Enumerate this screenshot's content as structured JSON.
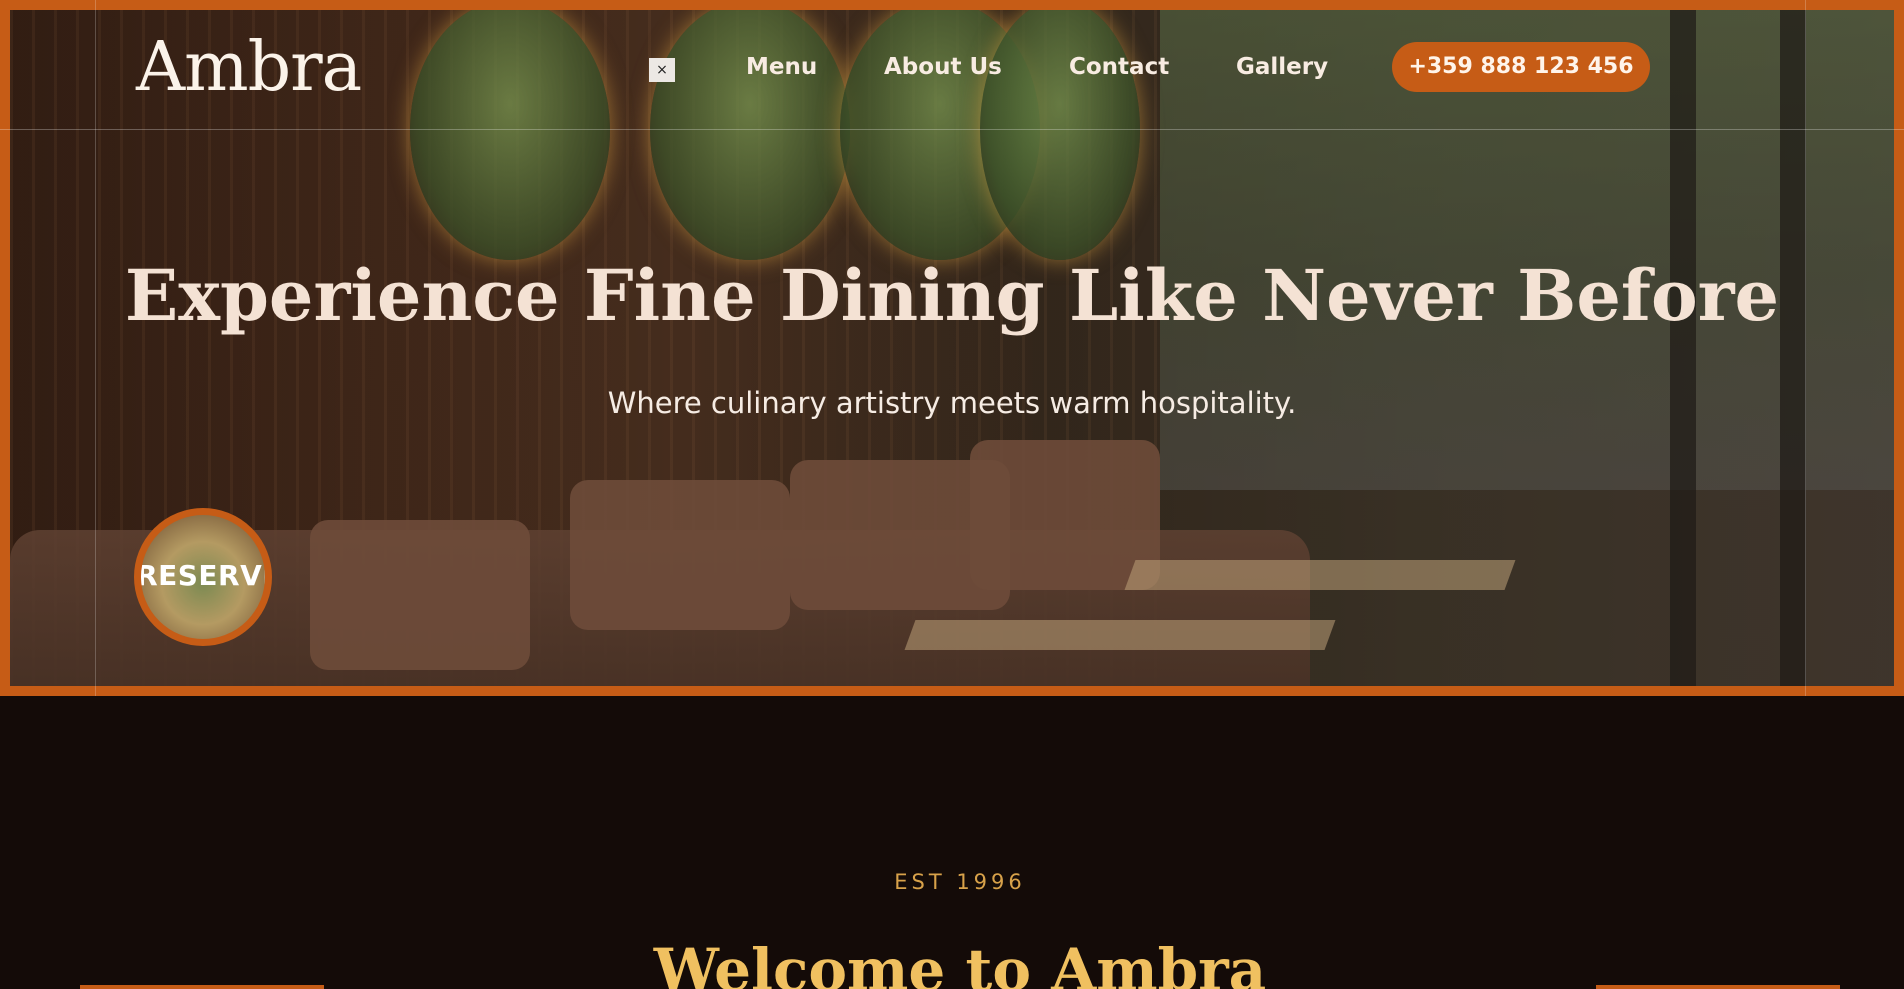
{
  "brand": {
    "logo_text": "Ambra"
  },
  "nav": {
    "close_label": "×",
    "links": [
      "Menu",
      "About Us",
      "Contact",
      "Gallery"
    ],
    "phone": "+359 888 123 456"
  },
  "hero": {
    "title": "Experience Fine Dining Like Never Before",
    "subtitle": "Where culinary artistry meets warm hospitality.",
    "reserve_label": "RESERVE"
  },
  "welcome": {
    "eyebrow": "EST 1996",
    "title": "Welcome to Ambra"
  },
  "colors": {
    "accent": "#c65c16",
    "gold": "#f0c060",
    "background": "#140b08",
    "hero_text": "#f4e2d4"
  }
}
